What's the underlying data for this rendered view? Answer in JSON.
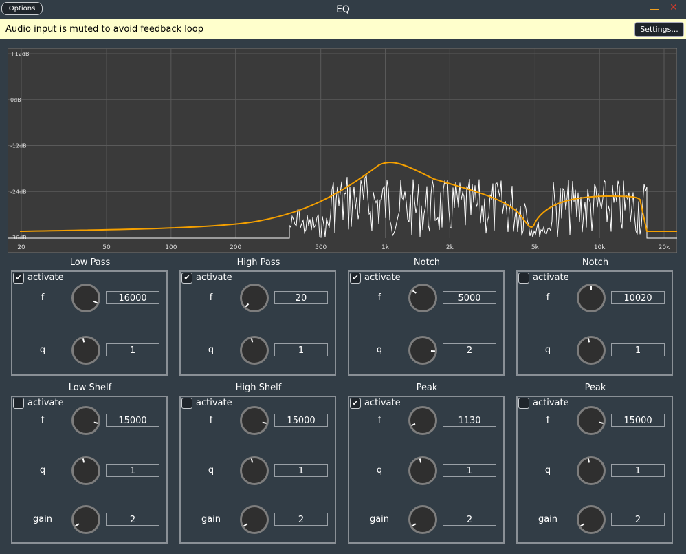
{
  "window": {
    "title": "EQ",
    "options_label": "Options",
    "minimize_glyph": "",
    "close_glyph": "✕"
  },
  "banner": {
    "message": "Audio input is muted to avoid feedback loop",
    "settings_label": "Settings..."
  },
  "graph": {
    "db_labels": [
      "+12dB",
      "0dB",
      "-12dB",
      "-24dB",
      "-36dB"
    ],
    "freq_labels": [
      "20",
      "50",
      "100",
      "200",
      "500",
      "1k",
      "2k",
      "5k",
      "10k",
      "20k"
    ],
    "curve_color": "#f5a000",
    "spectrum_color": "#ffffff"
  },
  "filters": [
    {
      "title": "Low Pass",
      "activate_label": "activate",
      "active": true,
      "params": [
        {
          "label": "f",
          "value": "16000",
          "level": 0.92
        },
        {
          "label": "q",
          "value": "1",
          "level": 0.45
        }
      ]
    },
    {
      "title": "High Pass",
      "activate_label": "activate",
      "active": true,
      "params": [
        {
          "label": "f",
          "value": "20",
          "level": 0.0
        },
        {
          "label": "q",
          "value": "1",
          "level": 0.45
        }
      ]
    },
    {
      "title": "Notch",
      "activate_label": "activate",
      "active": true,
      "params": [
        {
          "label": "f",
          "value": "5000",
          "level": 0.3
        },
        {
          "label": "q",
          "value": "2",
          "level": 0.85
        }
      ]
    },
    {
      "title": "Notch",
      "activate_label": "activate",
      "active": false,
      "params": [
        {
          "label": "f",
          "value": "10020",
          "level": 0.5
        },
        {
          "label": "q",
          "value": "1",
          "level": 0.45
        }
      ]
    },
    {
      "title": "Low Shelf",
      "activate_label": "activate",
      "active": false,
      "params": [
        {
          "label": "f",
          "value": "15000",
          "level": 0.88
        },
        {
          "label": "q",
          "value": "1",
          "level": 0.45
        },
        {
          "label": "gain",
          "value": "2",
          "level": 0.05
        }
      ]
    },
    {
      "title": "High Shelf",
      "activate_label": "activate",
      "active": false,
      "params": [
        {
          "label": "f",
          "value": "15000",
          "level": 0.88
        },
        {
          "label": "q",
          "value": "1",
          "level": 0.45
        },
        {
          "label": "gain",
          "value": "2",
          "level": 0.05
        }
      ]
    },
    {
      "title": "Peak",
      "activate_label": "activate",
      "active": true,
      "params": [
        {
          "label": "f",
          "value": "1130",
          "level": 0.08
        },
        {
          "label": "q",
          "value": "1",
          "level": 0.45
        },
        {
          "label": "gain",
          "value": "2",
          "level": 0.05
        }
      ]
    },
    {
      "title": "Peak",
      "activate_label": "activate",
      "active": false,
      "params": [
        {
          "label": "f",
          "value": "15000",
          "level": 0.88
        },
        {
          "label": "q",
          "value": "1",
          "level": 0.45
        },
        {
          "label": "gain",
          "value": "2",
          "level": 0.05
        }
      ]
    }
  ],
  "check_glyph": "✔"
}
